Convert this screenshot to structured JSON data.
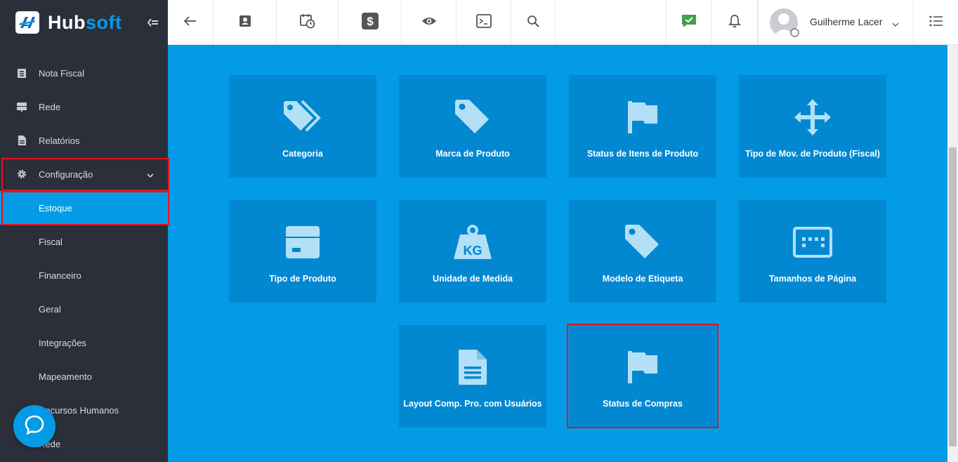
{
  "brand": {
    "name_main": "Hub",
    "name_accent": "soft"
  },
  "sidebar": {
    "items": [
      {
        "label": "Nota Fiscal",
        "icon": "document-list-icon"
      },
      {
        "label": "Rede",
        "icon": "server-icon"
      },
      {
        "label": "Relatórios",
        "icon": "report-icon"
      },
      {
        "label": "Configuração",
        "icon": "gear-icon"
      },
      {
        "label": "Estoque"
      },
      {
        "label": "Fiscal"
      },
      {
        "label": "Financeiro"
      },
      {
        "label": "Geral"
      },
      {
        "label": "Integrações"
      },
      {
        "label": "Mapeamento"
      },
      {
        "label": "Recursos Humanos"
      },
      {
        "label": "Rede"
      }
    ]
  },
  "topbar": {
    "icons": [
      "back-arrow-icon",
      "contact-card-icon",
      "calendar-clock-icon",
      "dollar-icon",
      "eye-icon",
      "terminal-icon",
      "search-icon"
    ],
    "user_name": "Guilherme Lacer"
  },
  "tiles": [
    {
      "label": "Categoria",
      "icon": "tags-icon"
    },
    {
      "label": "Marca de Produto",
      "icon": "tag-icon"
    },
    {
      "label": "Status de Itens de Produto",
      "icon": "flag-icon"
    },
    {
      "label": "Tipo de Mov. de Produto (Fiscal)",
      "icon": "move-arrows-icon"
    },
    {
      "label": "Tipo de Produto",
      "icon": "box-icon"
    },
    {
      "label": "Unidade de Medida",
      "icon": "weight-kg-icon",
      "icon_text": "KG"
    },
    {
      "label": "Modelo de Etiqueta",
      "icon": "tag-icon"
    },
    {
      "label": "Tamanhos de Página",
      "icon": "page-size-icon"
    },
    {
      "label": "Layout Comp. Pro. com Usuários",
      "icon": "file-text-icon"
    },
    {
      "label": "Status de Compras",
      "icon": "flag-icon"
    }
  ],
  "colors": {
    "accent": "#039be5",
    "tile": "#0288d1",
    "sidebar": "#2b2f3a",
    "highlight": "#e1141e",
    "notify": "#43a047"
  }
}
